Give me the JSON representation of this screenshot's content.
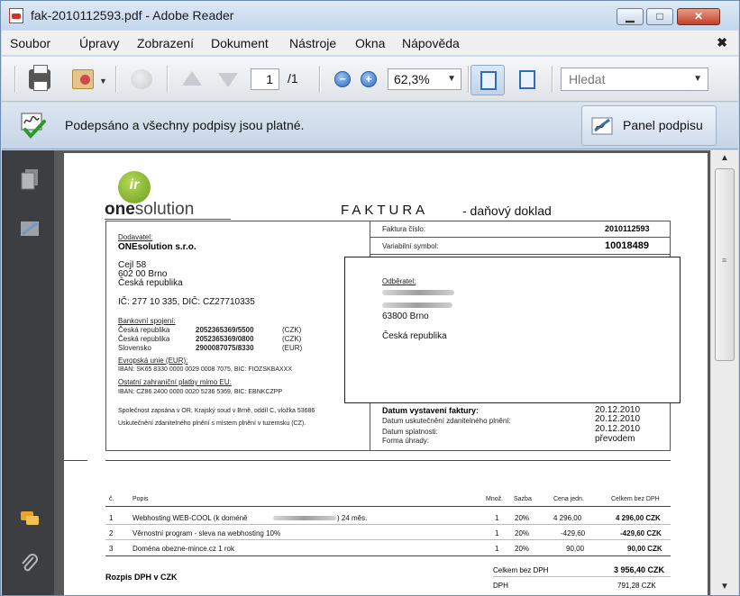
{
  "window": {
    "title": "fak-2010112593.pdf - Adobe Reader",
    "min_glyph": "▁",
    "max_glyph": "□",
    "close_glyph": "✕"
  },
  "menu": {
    "items": [
      "Soubor",
      "Úpravy",
      "Zobrazení",
      "Dokument",
      "Nástroje",
      "Okna",
      "Nápověda"
    ],
    "close_doc": "✖"
  },
  "toolbar": {
    "page_current": "1",
    "page_total": "/1",
    "zoom_out": "−",
    "zoom_in": "+",
    "zoom_value": "62,3%",
    "search_placeholder": "Hledat"
  },
  "signature_bar": {
    "status_text": "Podepsáno a všechny podpisy jsou platné.",
    "panel_button": "Panel podpisu"
  },
  "invoice": {
    "logo_mark": "ir",
    "logo_bold": "one",
    "logo_light": "solution",
    "title": "FAKTURA",
    "subtitle": "- daňový doklad",
    "invoice_number_label": "Faktura číslo:",
    "invoice_number": "2010112593",
    "variable_symbol_label": "Variabilní symbol:",
    "variable_symbol": "10018489",
    "supplier_label": "Dodavatel:",
    "supplier_name": "ONEsolution s.r.o.",
    "supplier_street": "Cejl 58",
    "supplier_city": "602 00  Brno",
    "supplier_country": "Česká republika",
    "supplier_ids": "IČ: 277 10 335, DIČ: CZ27710335",
    "bank_label": "Bankovní spojení:",
    "banks": [
      {
        "country": "Česká republika",
        "account": "2052365369/5500",
        "currency": "(CZK)"
      },
      {
        "country": "Česká republika",
        "account": "2052365369/0800",
        "currency": "(CZK)"
      },
      {
        "country": "Slovensko",
        "account": "2900087075/8330",
        "currency": "(EUR)"
      }
    ],
    "eu_label": "Evropská unie (EUR):",
    "eu_iban": "IBAN: SK65 8330 0000 0029 0008 7075, BIC: FIOZSKBAXXX",
    "other_label": "Ostatní zahraniční platby mimo EU:",
    "other_iban": "IBAN: CZ86 2400 0000 0020 5236 5369, BIC: EBNKCZPP",
    "registry_note": "Společnost zapsána v OR, Krajský soud v Brně, oddíl C, vložka 53686",
    "vat_note": "Uskutečnění zdanitelného plnění s místem plnění v tuzemsku (CZ).",
    "customer_label": "Odběratel:",
    "customer_city": "63800 Brno",
    "customer_country": "Česká republika",
    "dates": [
      {
        "label": "Datum vystavení faktury:",
        "value": "20.12.2010"
      },
      {
        "label": "Datum uskutečnění zdanitelného plnění:",
        "value": "20.12.2010"
      },
      {
        "label": "Datum splatnosti:",
        "value": "20.12.2010"
      },
      {
        "label": "Forma úhrady:",
        "value": "převodem"
      }
    ],
    "items_header": {
      "num": "č.",
      "desc": "Popis",
      "qty": "Množ.",
      "rate": "Sazba",
      "unit": "Cena jedn.",
      "total": "Celkem bez DPH"
    },
    "items": [
      {
        "num": "1",
        "desc_a": "Webhosting WEB-COOL (k doméně",
        "desc_b": ") 24 měs.",
        "qty": "1",
        "rate": "20%",
        "unit": "4 296,00",
        "total": "4 296,00 CZK"
      },
      {
        "num": "2",
        "desc_a": "Věrnostní program - sleva na webhosting 10%",
        "desc_b": "",
        "qty": "1",
        "rate": "20%",
        "unit": "-429,60",
        "total": "-429,60 CZK"
      },
      {
        "num": "3",
        "desc_a": "Doména obezne-mince.cz 1 rok",
        "desc_b": "",
        "qty": "1",
        "rate": "20%",
        "unit": "90,00",
        "total": "90,00 CZK"
      }
    ],
    "subtotal_label": "Celkem bez DPH",
    "subtotal_value": "3 956,40 CZK",
    "vat_row_label": "DPH",
    "vat_row_value": "791,28 CZK",
    "vat_breakdown_title": "Rozpis DPH v CZK"
  },
  "scrollbar": {
    "up": "▲",
    "down": "▼",
    "grip": "≡"
  }
}
